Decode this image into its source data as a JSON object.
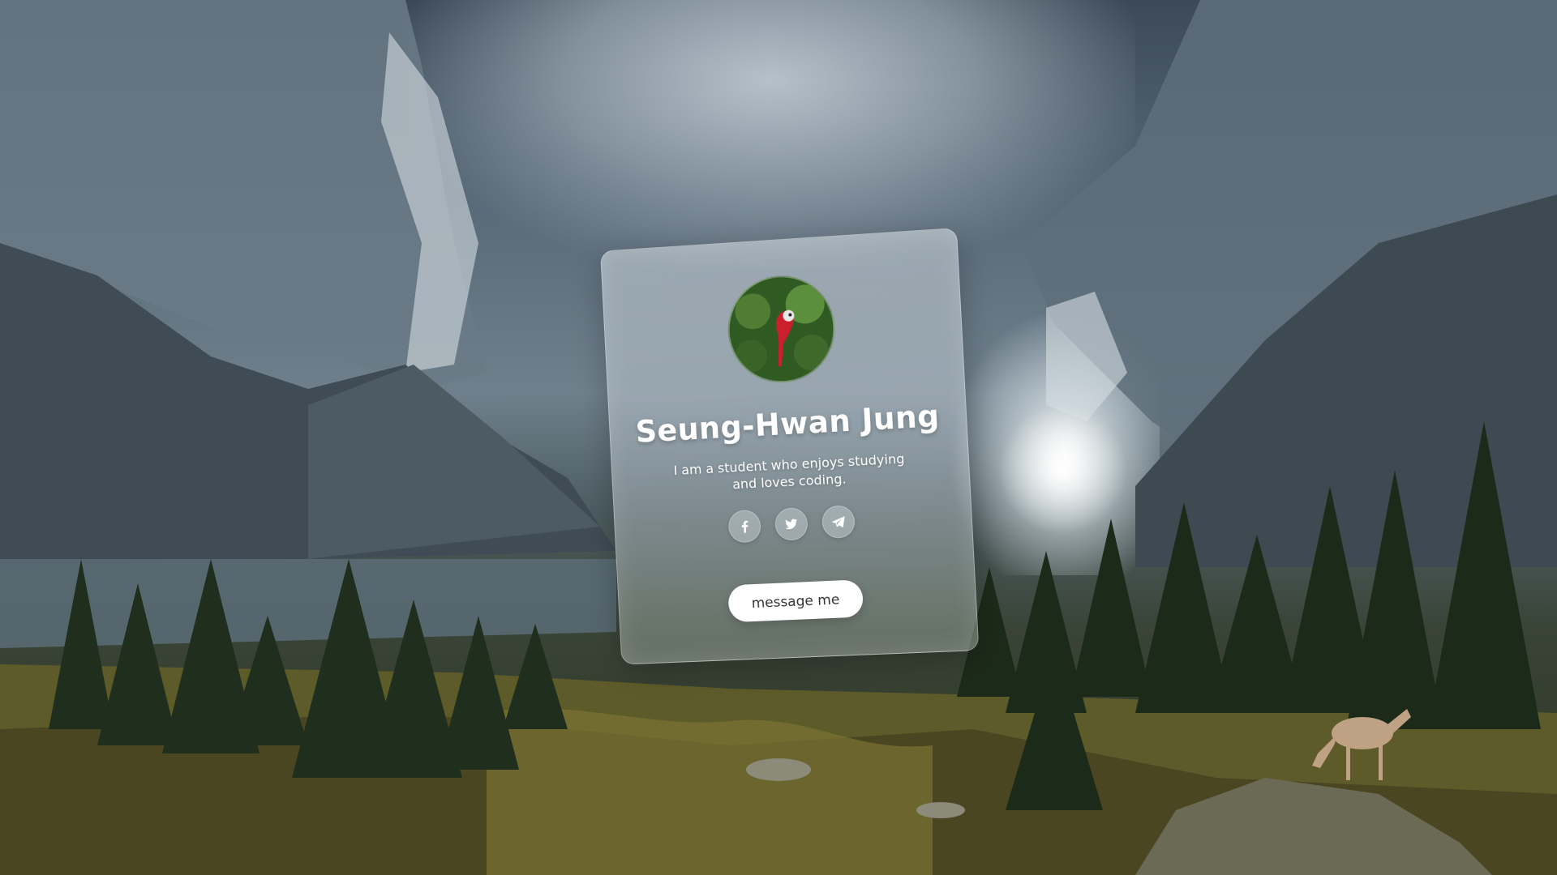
{
  "profile": {
    "name": "Seung-Hwan Jung",
    "bio": "I am a student who enjoys studying and loves coding.",
    "avatar_icon": "parrot-avatar"
  },
  "socials": [
    {
      "name": "facebook",
      "icon": "facebook-icon"
    },
    {
      "name": "twitter",
      "icon": "twitter-icon"
    },
    {
      "name": "telegram",
      "icon": "telegram-icon"
    }
  ],
  "actions": {
    "message_label": "message me"
  },
  "colors": {
    "button_bg": "#ffffff",
    "text": "#ffffff",
    "button_text": "#333333"
  }
}
